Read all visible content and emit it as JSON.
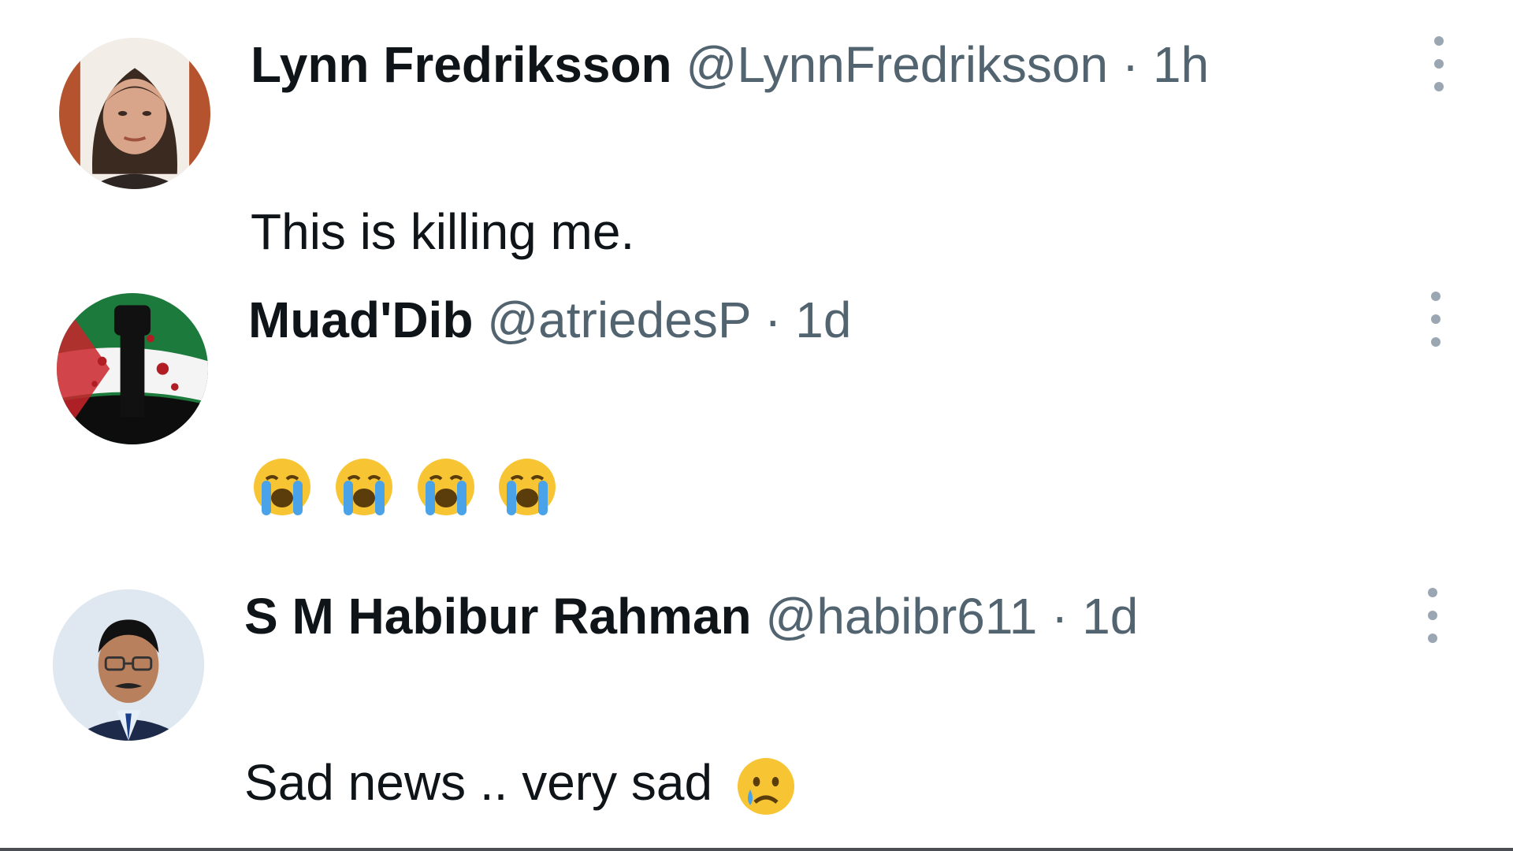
{
  "replies": [
    {
      "name": "Lynn Fredriksson",
      "handle": "@LynnFredriksson",
      "separator": "·",
      "time": "1h",
      "text": "This is killing me."
    },
    {
      "name": "Muad'Dib",
      "handle": "@atriedesP",
      "separator": "·",
      "time": "1d",
      "emoji": [
        "loudly-crying-face",
        "loudly-crying-face",
        "loudly-crying-face",
        "loudly-crying-face"
      ]
    },
    {
      "name": "S M Habibur Rahman",
      "handle": "@habibr611",
      "separator": "·",
      "time": "1d",
      "text": "Sad news .. very sad",
      "emoji": "crying-face"
    }
  ],
  "colors": {
    "name": "#0f1419",
    "secondary": "#536471",
    "more_dots": "#9aa6b1",
    "emoji_face": "#f7c433",
    "emoji_tear": "#4aa3e8"
  }
}
